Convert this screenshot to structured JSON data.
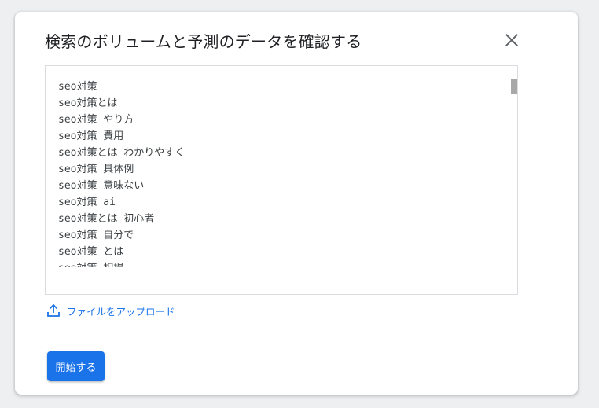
{
  "dialog": {
    "title": "検索のボリュームと予測のデータを確認する",
    "close_icon": "close-icon",
    "keywords_text": "seo対策\nseo対策とは\nseo対策 やり方\nseo対策 費用\nseo対策とは わかりやすく\nseo対策 具体例\nseo対策 意味ない\nseo対策 ai\nseo対策とは 初心者\nseo対策 自分で\nseo対策 とは\nseo対策 相場",
    "upload_label": "ファイルをアップロード",
    "upload_icon": "upload-icon",
    "start_button_label": "開始する"
  },
  "colors": {
    "accent": "#1a73e8",
    "background": "#eeeff1",
    "text": "#202124"
  }
}
